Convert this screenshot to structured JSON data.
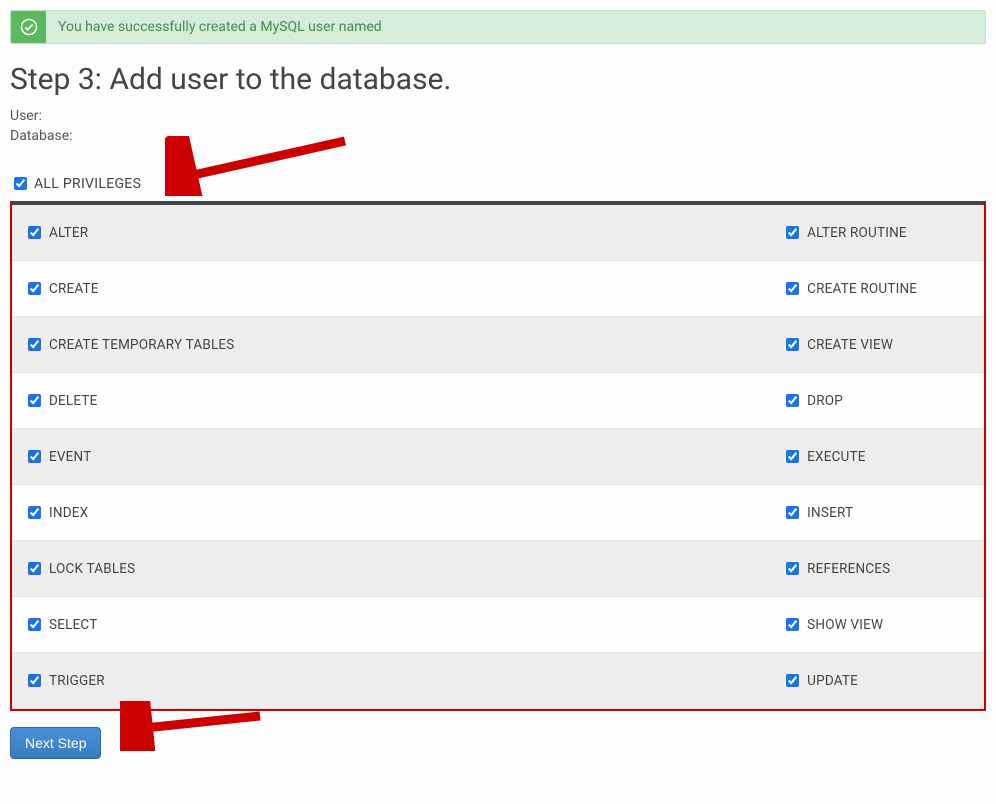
{
  "alert": {
    "message": "You have successfully created a MySQL user named"
  },
  "step": {
    "title": "Step 3: Add user to the database.",
    "user_label": "User:",
    "user_value": "",
    "database_label": "Database:",
    "database_value": ""
  },
  "all_privileges": {
    "label": "ALL PRIVILEGES",
    "checked": true
  },
  "privileges": [
    {
      "left": "ALTER",
      "right": "ALTER ROUTINE"
    },
    {
      "left": "CREATE",
      "right": "CREATE ROUTINE"
    },
    {
      "left": "CREATE TEMPORARY TABLES",
      "right": "CREATE VIEW"
    },
    {
      "left": "DELETE",
      "right": "DROP"
    },
    {
      "left": "EVENT",
      "right": "EXECUTE"
    },
    {
      "left": "INDEX",
      "right": "INSERT"
    },
    {
      "left": "LOCK TABLES",
      "right": "REFERENCES"
    },
    {
      "left": "SELECT",
      "right": "SHOW VIEW"
    },
    {
      "left": "TRIGGER",
      "right": "UPDATE"
    }
  ],
  "buttons": {
    "next_step": "Next Step"
  },
  "annotations": {
    "arrow_color": "#cc0000",
    "box_color": "#cc0000"
  }
}
